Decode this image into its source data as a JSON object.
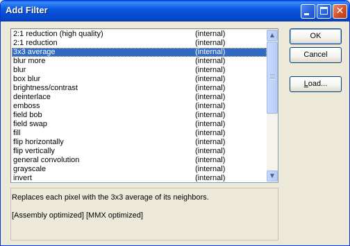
{
  "window": {
    "title": "Add Filter"
  },
  "filters": [
    {
      "name": "2:1 reduction (high quality)",
      "source": "(internal)",
      "selected": false
    },
    {
      "name": "2:1 reduction",
      "source": "(internal)",
      "selected": false
    },
    {
      "name": "3x3 average",
      "source": "(internal)",
      "selected": true
    },
    {
      "name": "blur more",
      "source": "(internal)",
      "selected": false
    },
    {
      "name": "blur",
      "source": "(internal)",
      "selected": false
    },
    {
      "name": "box blur",
      "source": "(internal)",
      "selected": false
    },
    {
      "name": "brightness/contrast",
      "source": "(internal)",
      "selected": false
    },
    {
      "name": "deinterlace",
      "source": "(internal)",
      "selected": false
    },
    {
      "name": "emboss",
      "source": "(internal)",
      "selected": false
    },
    {
      "name": "field bob",
      "source": "(internal)",
      "selected": false
    },
    {
      "name": "field swap",
      "source": "(internal)",
      "selected": false
    },
    {
      "name": "fill",
      "source": "(internal)",
      "selected": false
    },
    {
      "name": "flip horizontally",
      "source": "(internal)",
      "selected": false
    },
    {
      "name": "flip vertically",
      "source": "(internal)",
      "selected": false
    },
    {
      "name": "general convolution",
      "source": "(internal)",
      "selected": false
    },
    {
      "name": "grayscale",
      "source": "(internal)",
      "selected": false
    },
    {
      "name": "invert",
      "source": "(internal)",
      "selected": false
    }
  ],
  "description": {
    "line1": "Replaces each pixel with the 3x3 average of its neighbors.",
    "line2": "[Assembly optimized] [MMX optimized]"
  },
  "buttons": {
    "ok": "OK",
    "cancel": "Cancel",
    "load_prefix": "",
    "load_mnemonic": "L",
    "load_rest": "oad..."
  },
  "scrollbar": {
    "thumb_position_fraction": 0.0,
    "visible_fraction": 0.48
  },
  "colors": {
    "selection": "#316ac5",
    "titlebar": "#0b58e0",
    "dialog": "#ece9d8"
  },
  "icons": {
    "close": "close-icon",
    "minimize": "minimize-icon",
    "maximize": "maximize-icon",
    "up": "scroll-up-arrow-icon",
    "down": "scroll-down-arrow-icon"
  }
}
